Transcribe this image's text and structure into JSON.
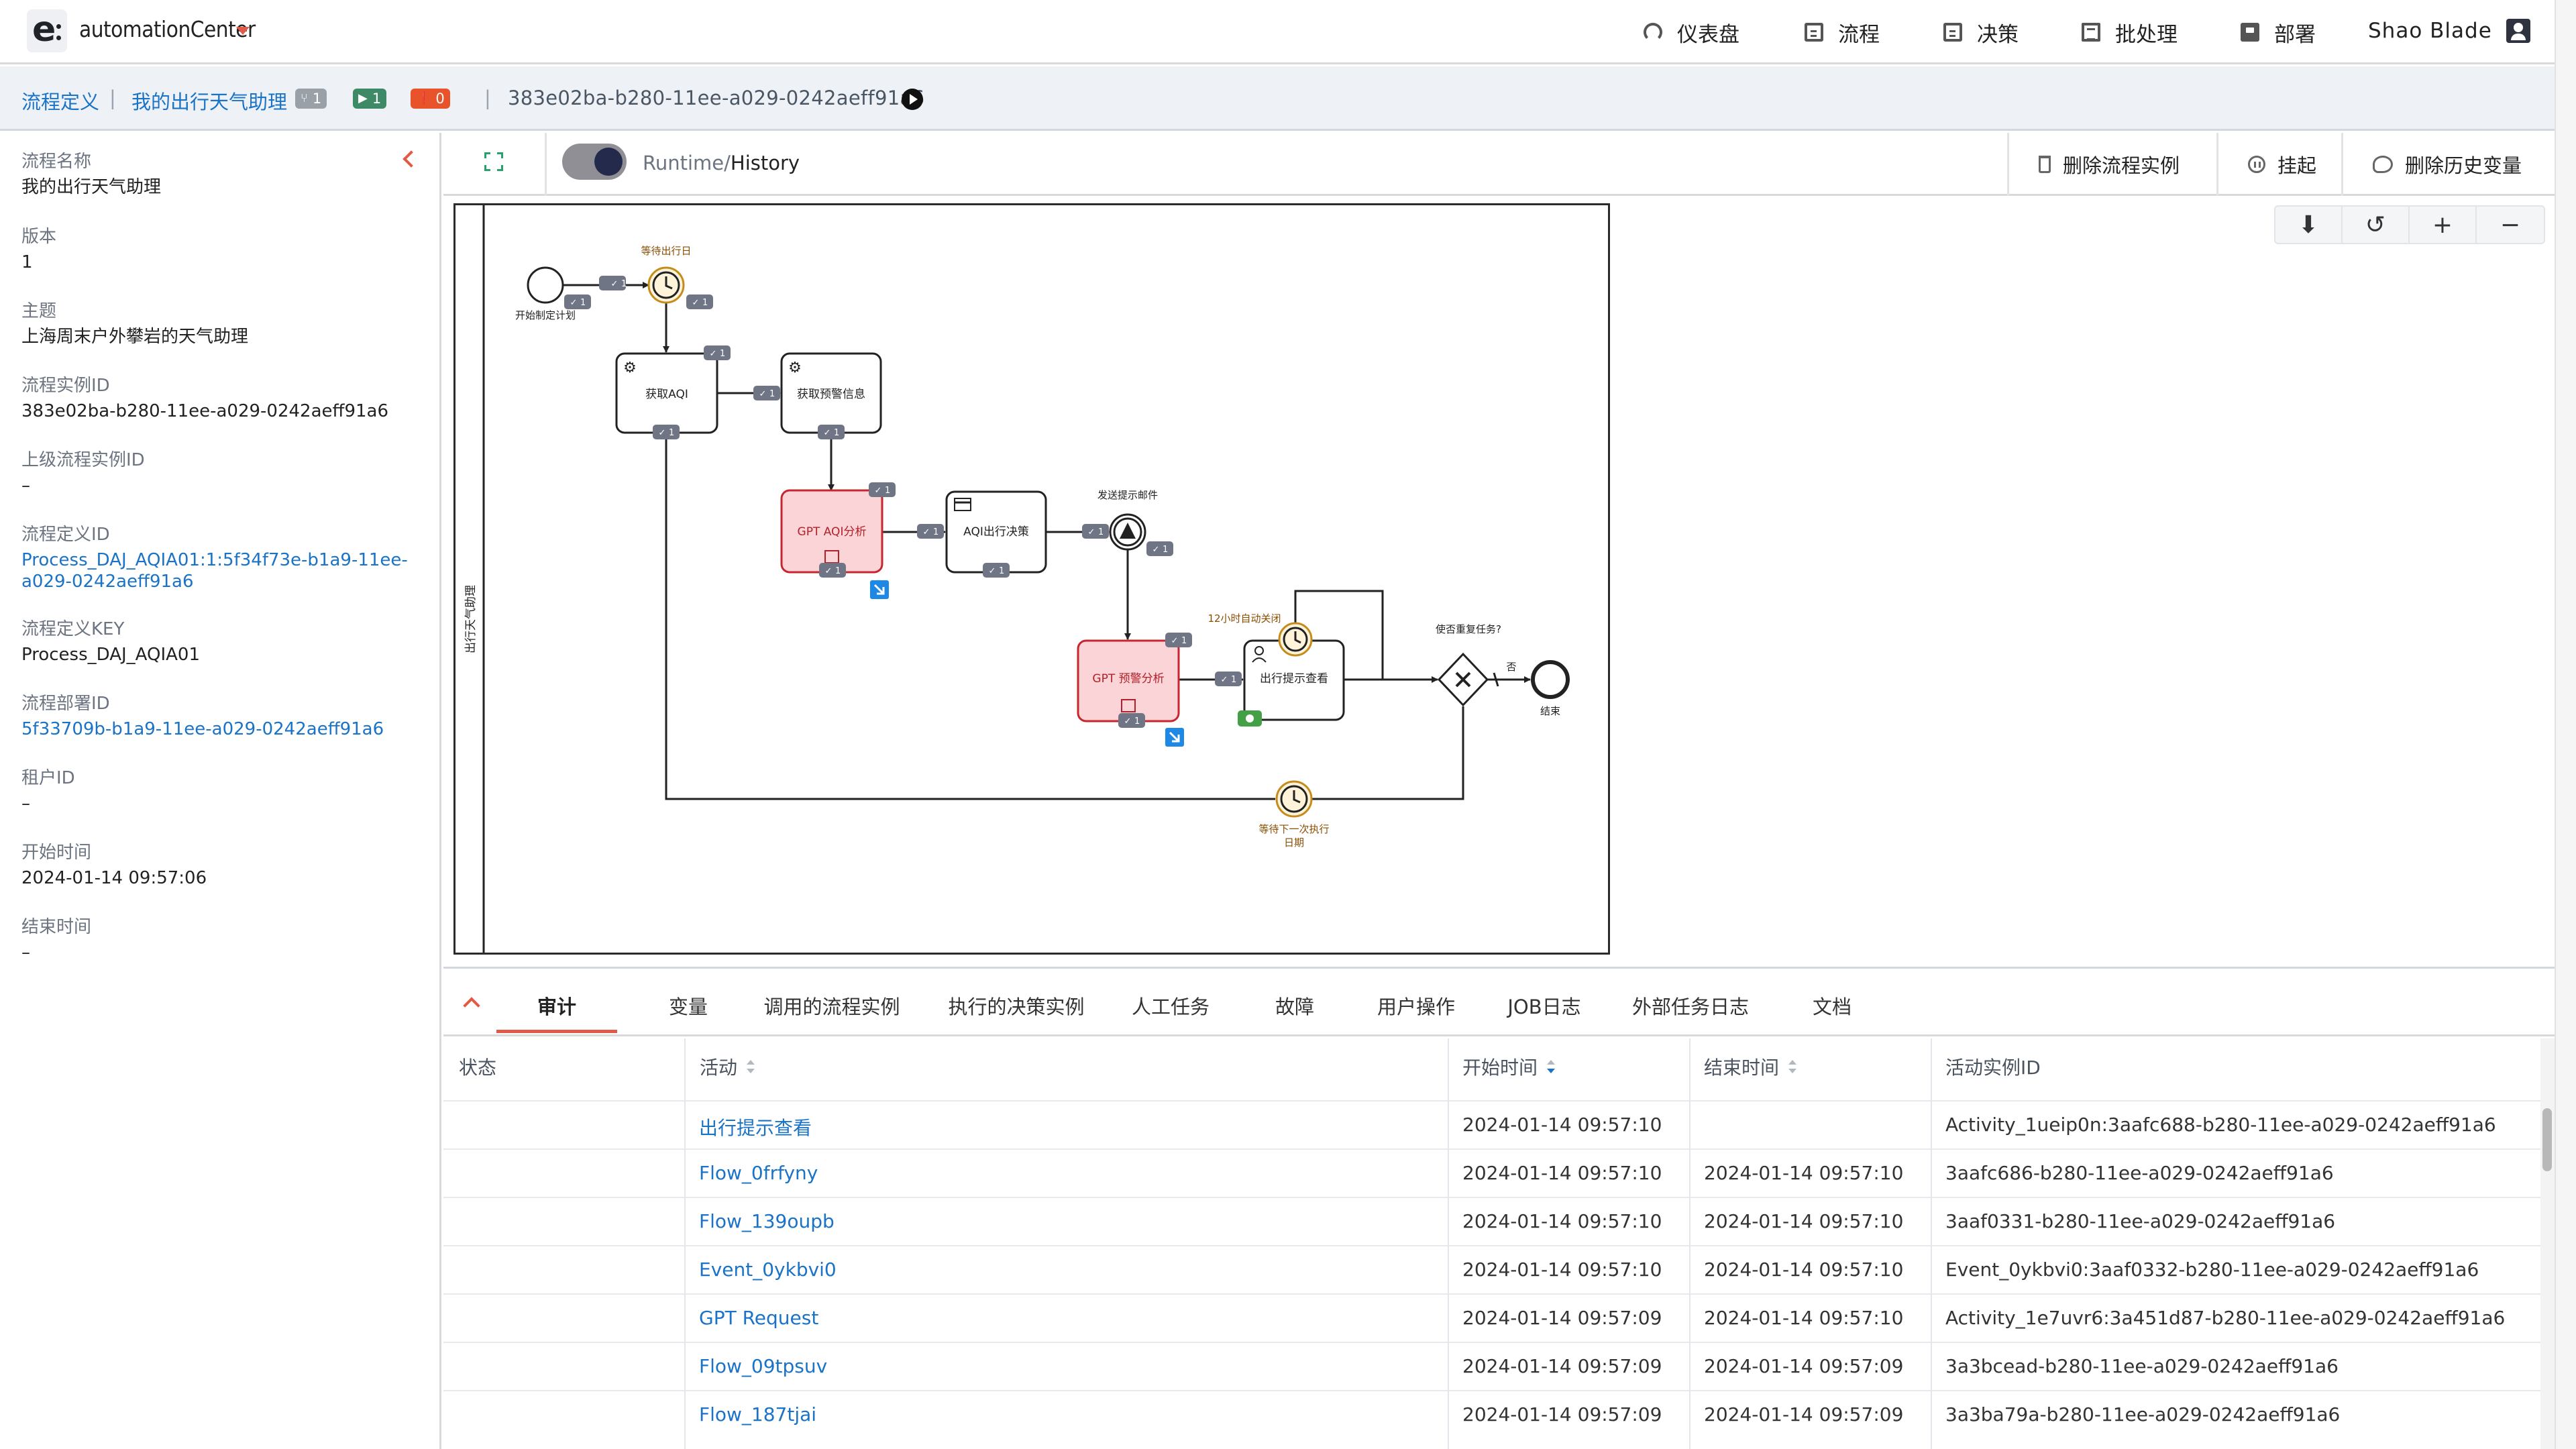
{
  "app": {
    "name": "automationCenter",
    "logo_letter": "e"
  },
  "topnav": [
    {
      "label": "仪表盘",
      "icon": "dashboard-gauge-icon"
    },
    {
      "label": "流程",
      "icon": "process-doc-icon"
    },
    {
      "label": "决策",
      "icon": "decision-doc-icon"
    },
    {
      "label": "批处理",
      "icon": "batch-list-icon"
    },
    {
      "label": "部署",
      "icon": "deploy-icon"
    }
  ],
  "user": {
    "name": "Shao Blade",
    "icon": "user-account-icon"
  },
  "breadcrumb": {
    "root": "流程定义",
    "process": "我的出行天气助理",
    "badges": [
      {
        "value": "1",
        "icon": "branch-icon",
        "color": "#9aa0a8"
      },
      {
        "value": "1",
        "icon": "play-icon",
        "color": "#3e8a66"
      },
      {
        "value": "0",
        "icon": "error-icon",
        "color": "#e8532b"
      }
    ],
    "instance_id": "383e02ba-b280-11ee-a029-0242aeff91a6"
  },
  "details": [
    {
      "label": "流程名称",
      "value": "我的出行天气助理",
      "link": false
    },
    {
      "label": "版本",
      "value": "1",
      "link": false
    },
    {
      "label": "主题",
      "value": "上海周末户外攀岩的天气助理",
      "link": false
    },
    {
      "label": "流程实例ID",
      "value": "383e02ba-b280-11ee-a029-0242aeff91a6",
      "link": false
    },
    {
      "label": "上级流程实例ID",
      "value": "–",
      "link": false
    },
    {
      "label": "流程定义ID",
      "value": "Process_DAJ_AQIA01:1:5f34f73e-b1a9-11ee-",
      "value2": "a029-0242aeff91a6",
      "link": true
    },
    {
      "label": "流程定义KEY",
      "value": "Process_DAJ_AQIA01",
      "link": false
    },
    {
      "label": "流程部署ID",
      "value": "5f33709b-b1a9-11ee-a029-0242aeff91a6",
      "link": true
    },
    {
      "label": "租户ID",
      "value": "–",
      "link": false
    },
    {
      "label": "开始时间",
      "value": "2024-01-14 09:57:06",
      "link": false
    },
    {
      "label": "结束时间",
      "value": "–",
      "link": false
    }
  ],
  "toolbar": {
    "mode_muted": "Runtime/",
    "mode_strong": "History",
    "buttons": [
      {
        "label": "删除流程实例",
        "icon": "trash-icon"
      },
      {
        "label": "挂起",
        "icon": "pause-icon"
      },
      {
        "label": "删除历史变量",
        "icon": "chat-clear-icon"
      }
    ],
    "zoom": [
      {
        "symbol": "⬇",
        "icon": "download-icon"
      },
      {
        "symbol": "↺",
        "icon": "reset-icon"
      },
      {
        "symbol": "+",
        "icon": "zoom-in-icon"
      },
      {
        "symbol": "−",
        "icon": "zoom-out-icon"
      }
    ]
  },
  "diagram": {
    "pool_label": "出行天气助理",
    "start_label": "开始制定计划",
    "timer_wait_label": "等待出行日",
    "task_get_aqi": "获取AQI",
    "task_get_alert": "获取预警信息",
    "task_gpt_aqi": "GPT AQI分析",
    "task_aqi_decision": "AQI出行决策",
    "event_send_mail": "发送提示邮件",
    "task_gpt_alert": "GPT 预警分析",
    "task_view": "出行提示查看",
    "timer_12h": "12小时自动关闭",
    "gateway_label": "使否重复任务?",
    "flow_no": "否",
    "end_label": "结束",
    "timer_next_1": "等待下一次执行",
    "timer_next_2": "日期",
    "count_badge": "1"
  },
  "tabs": [
    "审计",
    "变量",
    "调用的流程实例",
    "执行的决策实例",
    "人工任务",
    "故障",
    "用户操作",
    "JOB日志",
    "外部任务日志",
    "文档"
  ],
  "table": {
    "headers": [
      "状态",
      "活动",
      "开始时间",
      "结束时间",
      "活动实例ID"
    ],
    "rows": [
      {
        "activity": "出行提示查看",
        "start": "2024-01-14 09:57:10",
        "end": "",
        "id": "Activity_1ueip0n:3aafc688-b280-11ee-a029-0242aeff91a6"
      },
      {
        "activity": "Flow_0frfyny",
        "start": "2024-01-14 09:57:10",
        "end": "2024-01-14 09:57:10",
        "id": "3aafc686-b280-11ee-a029-0242aeff91a6"
      },
      {
        "activity": "Flow_139oupb",
        "start": "2024-01-14 09:57:10",
        "end": "2024-01-14 09:57:10",
        "id": "3aaf0331-b280-11ee-a029-0242aeff91a6"
      },
      {
        "activity": "Event_0ykbvi0",
        "start": "2024-01-14 09:57:10",
        "end": "2024-01-14 09:57:10",
        "id": "Event_0ykbvi0:3aaf0332-b280-11ee-a029-0242aeff91a6"
      },
      {
        "activity": "GPT Request",
        "start": "2024-01-14 09:57:09",
        "end": "2024-01-14 09:57:10",
        "id": "Activity_1e7uvr6:3a451d87-b280-11ee-a029-0242aeff91a6"
      },
      {
        "activity": "Flow_09tpsuv",
        "start": "2024-01-14 09:57:09",
        "end": "2024-01-14 09:57:09",
        "id": "3a3bcead-b280-11ee-a029-0242aeff91a6"
      },
      {
        "activity": "Flow_187tjai",
        "start": "2024-01-14 09:57:09",
        "end": "2024-01-14 09:57:09",
        "id": "3a3ba79a-b280-11ee-a029-0242aeff91a6"
      }
    ]
  }
}
